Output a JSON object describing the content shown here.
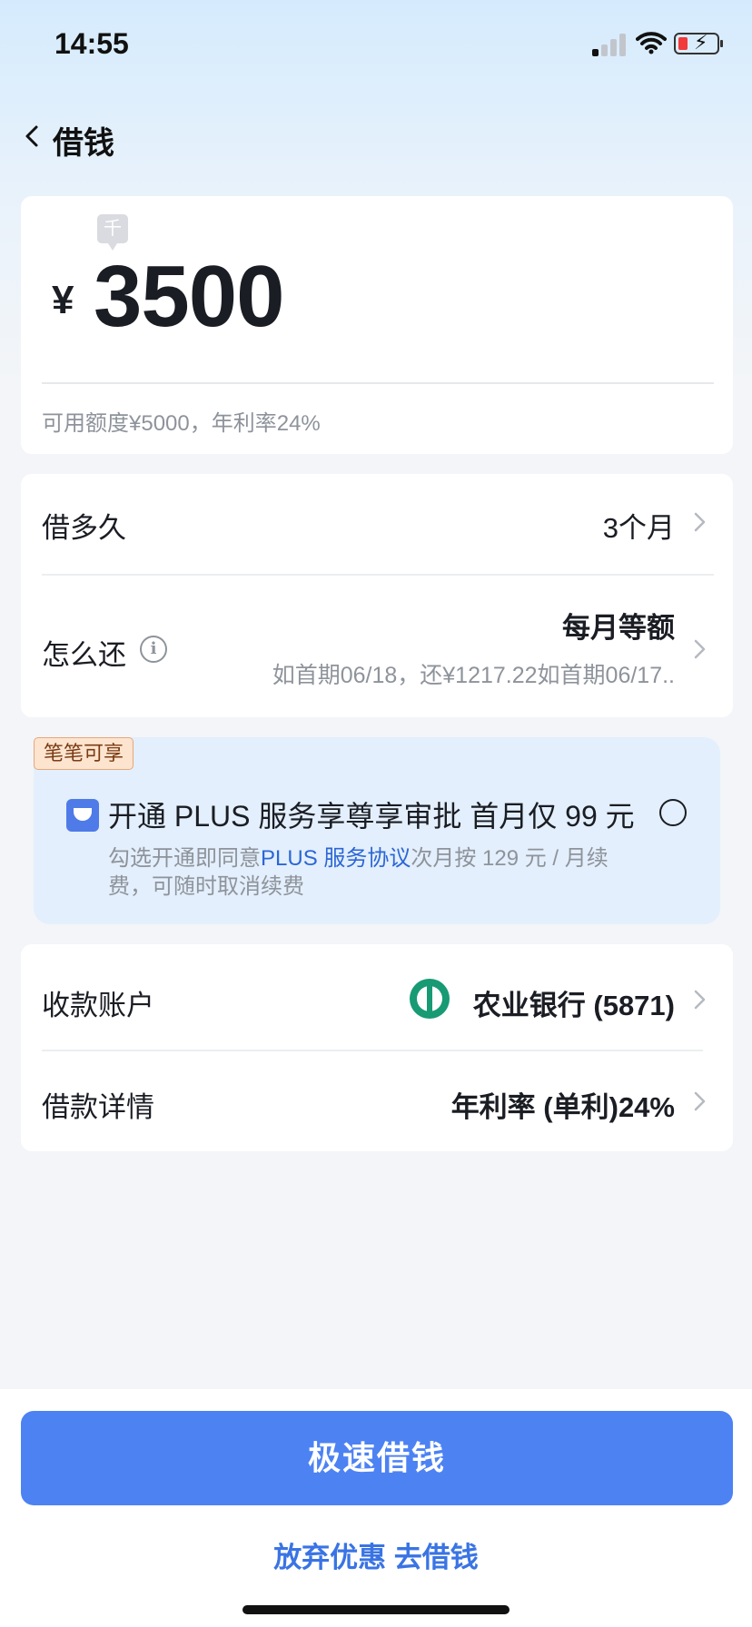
{
  "status_bar": {
    "time": "14:55"
  },
  "nav": {
    "title": "借钱"
  },
  "amount": {
    "unit_hint": "千",
    "currency_symbol": "¥",
    "value": "3500",
    "available_text": "可用额度¥5000，年利率24%"
  },
  "term": {
    "label": "借多久",
    "value": "3个月"
  },
  "repay": {
    "label": "怎么还",
    "info_glyph": "i",
    "value": "每月等额",
    "sub": "如首期06/18，还¥1217.22如首期06/17.."
  },
  "promo": {
    "badge": "笔笔可享",
    "title": "开通 PLUS 服务享尊享审批  首月仅 99 元",
    "note_prefix": "勾选开通即同意",
    "note_link": "PLUS 服务协议",
    "note_suffix": "次月按 129 元 / 月续费，可随时取消续费"
  },
  "account": {
    "label": "收款账户",
    "bank": "农业银行 (5871)"
  },
  "details": {
    "label": "借款详情",
    "value": "年利率 (单利)24%"
  },
  "actions": {
    "primary": "极速借钱",
    "secondary": "放弃优惠 去借钱"
  },
  "colors": {
    "primary": "#4d82f3",
    "link": "#2c66d6",
    "bank_green": "#189a74"
  }
}
